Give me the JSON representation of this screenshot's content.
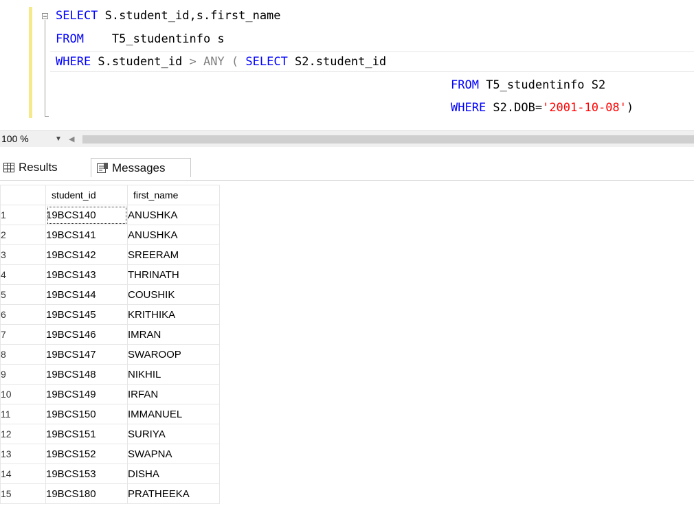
{
  "editor": {
    "lines": [
      {
        "kw1": "SELECT",
        "rest": " S.student_id,s.first_name"
      },
      {
        "kw1": "FROM",
        "rest": "    T5_studentinfo s"
      },
      {
        "kw1": "WHERE",
        "rest1": " S.student_id ",
        "op": "> ANY (",
        "kw2": "SELECT",
        "rest2": " S2.student_id"
      },
      {
        "kw1": "FROM",
        "rest": " T5_studentinfo S2"
      },
      {
        "kw1": "WHERE",
        "rest1": " S2.DOB=",
        "str": "'2001-10-08'",
        "rest2": ")"
      }
    ]
  },
  "zoom": {
    "value": "100 %"
  },
  "tabs": {
    "results": "Results",
    "messages": "Messages"
  },
  "results": {
    "columns": [
      "student_id",
      "first_name"
    ],
    "rows": [
      {
        "n": "1",
        "student_id": "19BCS140",
        "first_name": "ANUSHKA"
      },
      {
        "n": "2",
        "student_id": "19BCS141",
        "first_name": "ANUSHKA"
      },
      {
        "n": "3",
        "student_id": "19BCS142",
        "first_name": "SREERAM"
      },
      {
        "n": "4",
        "student_id": "19BCS143",
        "first_name": "THRINATH"
      },
      {
        "n": "5",
        "student_id": "19BCS144",
        "first_name": "COUSHIK"
      },
      {
        "n": "6",
        "student_id": "19BCS145",
        "first_name": "KRITHIKA"
      },
      {
        "n": "7",
        "student_id": "19BCS146",
        "first_name": "IMRAN"
      },
      {
        "n": "8",
        "student_id": "19BCS147",
        "first_name": "SWAROOP"
      },
      {
        "n": "9",
        "student_id": "19BCS148",
        "first_name": "NIKHIL"
      },
      {
        "n": "10",
        "student_id": "19BCS149",
        "first_name": "IRFAN"
      },
      {
        "n": "11",
        "student_id": "19BCS150",
        "first_name": "IMMANUEL"
      },
      {
        "n": "12",
        "student_id": "19BCS151",
        "first_name": "SURIYA"
      },
      {
        "n": "13",
        "student_id": "19BCS152",
        "first_name": "SWAPNA"
      },
      {
        "n": "14",
        "student_id": "19BCS153",
        "first_name": "DISHA"
      },
      {
        "n": "15",
        "student_id": "19BCS180",
        "first_name": "PRATHEEKA"
      }
    ]
  }
}
